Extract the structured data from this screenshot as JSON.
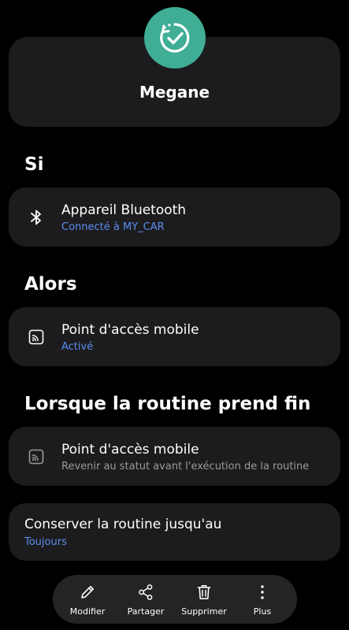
{
  "header": {
    "routine_name": "Megane",
    "icon": "routine-check-icon",
    "icon_color": "#3fae95"
  },
  "sections": {
    "if_title": "Si",
    "then_title": "Alors",
    "end_title": "Lorsque la routine prend fin"
  },
  "if_card": {
    "icon": "bluetooth-icon",
    "title": "Appareil Bluetooth",
    "subtitle": "Connecté à MY_CAR"
  },
  "then_card": {
    "icon": "mobile-hotspot-icon",
    "title": "Point d'accès mobile",
    "subtitle": "Activé"
  },
  "end_card": {
    "icon": "mobile-hotspot-icon",
    "title": "Point d'accès mobile",
    "subtitle": "Revenir au statut avant l'exécution de la routine"
  },
  "keep_card": {
    "title": "Conserver la routine jusqu'au",
    "subtitle": "Toujours"
  },
  "bottom_bar": {
    "edit_label": "Modifier",
    "share_label": "Partager",
    "delete_label": "Supprimer",
    "more_label": "Plus"
  },
  "colors": {
    "accent_blue": "#5b8def",
    "card_bg": "#1c1c1e",
    "background": "#000000"
  }
}
